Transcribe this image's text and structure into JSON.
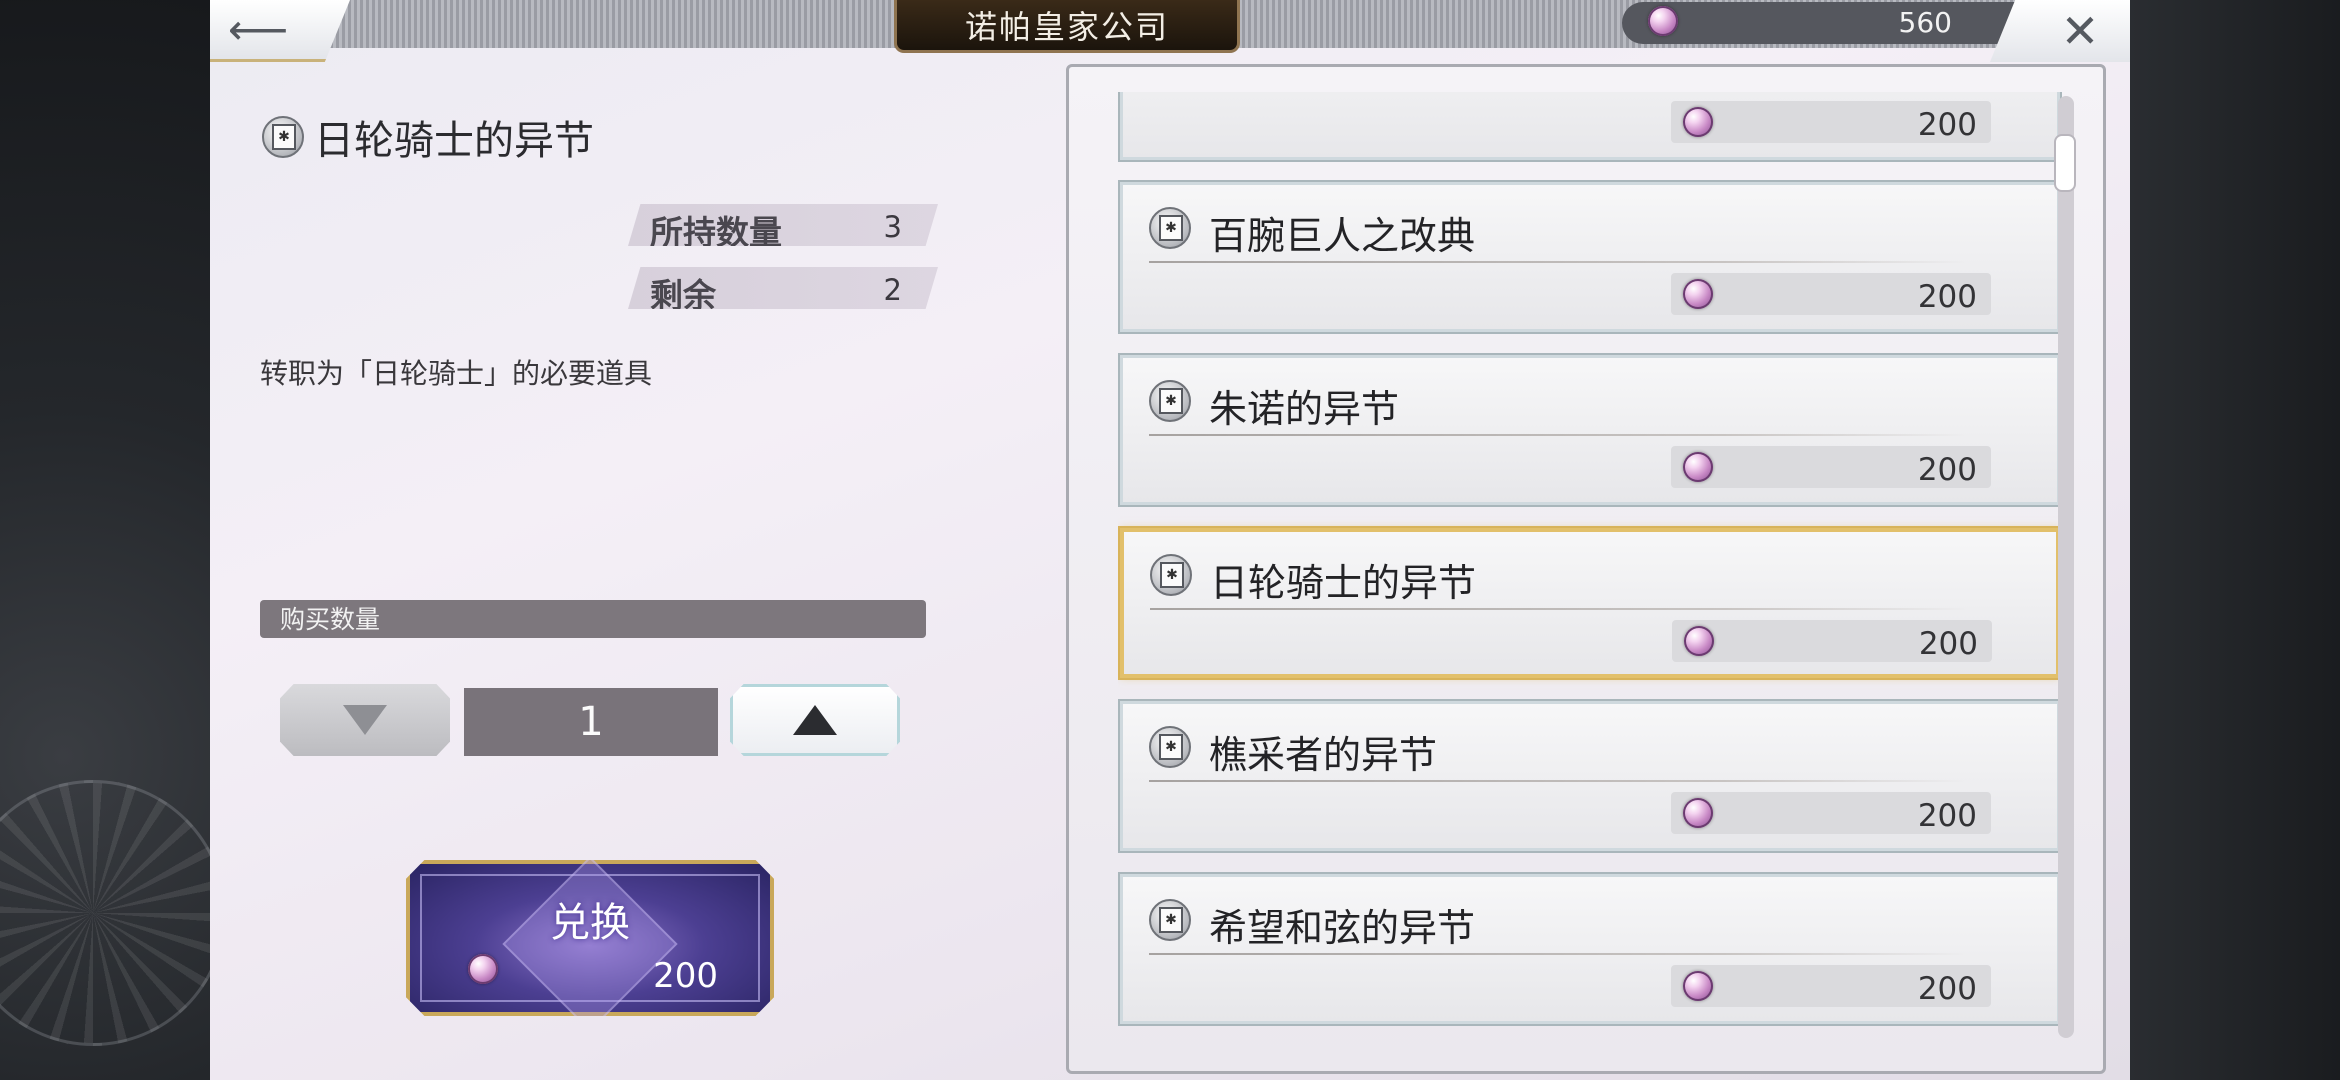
{
  "header": {
    "title": "诺帕皇家公司",
    "currency_amount": "560",
    "back_icon": "arrow-left-icon",
    "close_icon": "close-icon"
  },
  "detail": {
    "item_name": "日轮骑士的异节",
    "owned_label": "所持数量",
    "owned_value": "3",
    "remaining_label": "剩余",
    "remaining_value": "2",
    "description": "转职为「日轮骑士」的必要道具",
    "quantity_label": "购买数量",
    "quantity_value": "1",
    "exchange_label": "兑换",
    "exchange_cost": "200"
  },
  "shop_items": [
    {
      "name": "",
      "price": "200"
    },
    {
      "name": "百腕巨人之改典",
      "price": "200"
    },
    {
      "name": "朱诺的异节",
      "price": "200"
    },
    {
      "name": "日轮骑士的异节",
      "price": "200",
      "selected": true
    },
    {
      "name": "樵采者的异节",
      "price": "200"
    },
    {
      "name": "希望和弦的异节",
      "price": "200"
    }
  ],
  "colors": {
    "selected_border": "#e2c06b",
    "gem_purple": "#c98ac6",
    "exchange_button": "#4c3f92"
  }
}
